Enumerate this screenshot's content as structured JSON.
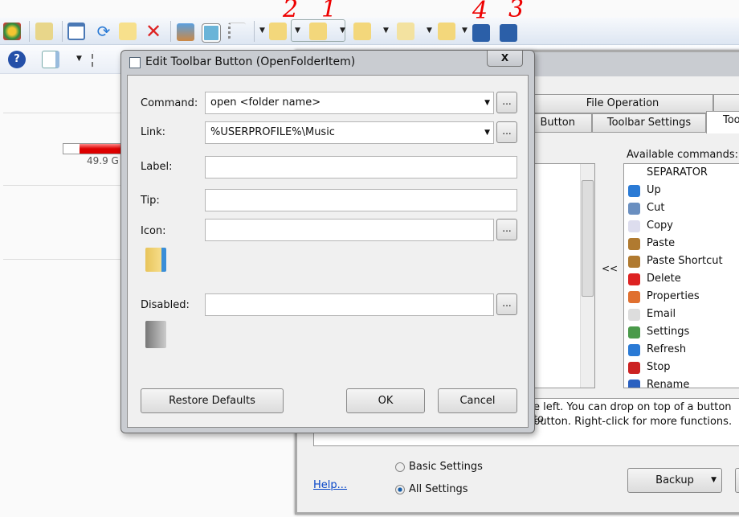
{
  "annotations": [
    "2",
    "1",
    "4",
    "3"
  ],
  "explorer": {
    "drive_free": "49.9 G",
    "drive_fill": 0.75
  },
  "settings": {
    "tabs_row1": [
      "File Operation",
      ""
    ],
    "tabs_row2": [
      "Button",
      "Toolbar Settings",
      "Too"
    ],
    "available_label": "Available commands:",
    "move_left": "<<",
    "commands": [
      {
        "label": "SEPARATOR",
        "icon": ""
      },
      {
        "label": "Up",
        "icon": "up-arrow-icon"
      },
      {
        "label": "Cut",
        "icon": "scissors-icon"
      },
      {
        "label": "Copy",
        "icon": "copy-icon"
      },
      {
        "label": "Paste",
        "icon": "clipboard-icon"
      },
      {
        "label": "Paste Shortcut",
        "icon": "clipboard-shortcut-icon"
      },
      {
        "label": "Delete",
        "icon": "red-x-icon"
      },
      {
        "label": "Properties",
        "icon": "checkmark-icon"
      },
      {
        "label": "Email",
        "icon": "envelope-icon"
      },
      {
        "label": "Settings",
        "icon": "settings-icon"
      },
      {
        "label": "Refresh",
        "icon": "refresh-icon"
      },
      {
        "label": "Stop",
        "icon": "stop-icon"
      },
      {
        "label": "Rename",
        "icon": "rename-icon"
      }
    ],
    "help_line1": "e left. You can drop on top of a button to",
    "help_line2": "button. Right-click for more functions.",
    "help_link": "Help...",
    "radio_basic": "Basic Settings",
    "radio_all": "All Settings",
    "backup": "Backup"
  },
  "dialog": {
    "title": "Edit Toolbar Button (OpenFolderItem)",
    "close": "X",
    "command_label": "Command:",
    "command_value": "open <folder name>",
    "link_label": "Link:",
    "link_value": "%USERPROFILE%\\Music",
    "label_label": "Label:",
    "label_value": "",
    "tip_label": "Tip:",
    "tip_value": "",
    "icon_label": "Icon:",
    "icon_value": "",
    "disabled_label": "Disabled:",
    "disabled_value": "",
    "browse": "...",
    "restore": "Restore Defaults",
    "ok": "OK",
    "cancel": "Cancel"
  }
}
